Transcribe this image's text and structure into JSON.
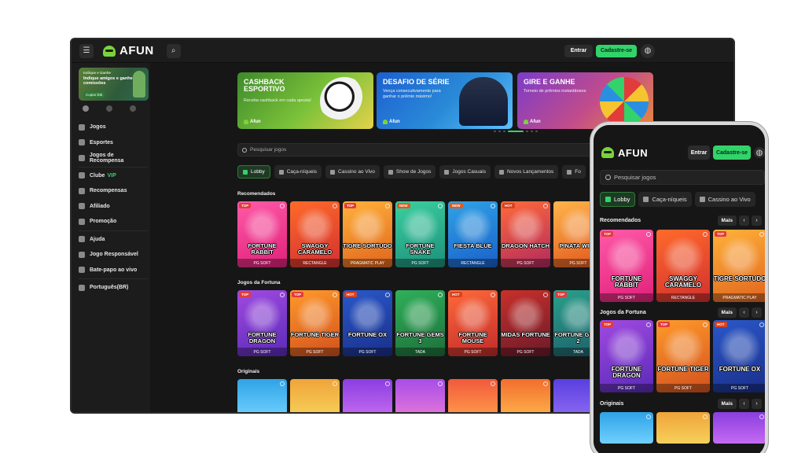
{
  "brand": {
    "name": "AFUN",
    "accent": "#32d36a"
  },
  "header": {
    "login_label": "Entrar",
    "signup_label": "Cadastre-se"
  },
  "sidebar": {
    "promo": {
      "kicker": "Indique e Ganhe",
      "title": "Indique amigos e ganhe comissões",
      "cta": "Copiar link"
    },
    "items": [
      {
        "label": "Jogos",
        "icon": "dice-icon"
      },
      {
        "label": "Esportes",
        "icon": "ball-icon"
      },
      {
        "label": "Jogos de Recompensa",
        "icon": "gift-icon"
      },
      {
        "label": "Clube",
        "extra": "VIP",
        "icon": "crown-icon"
      },
      {
        "label": "Recompensas",
        "icon": "calendar-icon"
      },
      {
        "label": "Afiliado",
        "icon": "users-icon"
      },
      {
        "label": "Promoção",
        "icon": "tag-icon"
      },
      {
        "label": "Ajuda",
        "icon": "help-icon"
      },
      {
        "label": "Jogo Responsável",
        "icon": "shield-icon"
      },
      {
        "label": "Bate-papo ao vivo",
        "icon": "headset-icon"
      },
      {
        "label": "Português(BR)",
        "icon": "globe-icon"
      }
    ]
  },
  "banners": [
    {
      "title": "CASHBACK ESPORTIVO",
      "subtitle": "Receba cashback em cada aposta!",
      "brand": "Afun"
    },
    {
      "title": "DESAFIO DE SÉRIE",
      "subtitle": "Vença consecutivamente para ganhar o prêmio máximo!",
      "brand": "Afun"
    },
    {
      "title": "GIRE E GANHE",
      "subtitle": "Torneio de prêmios instantâneos",
      "brand": "Afun"
    }
  ],
  "search": {
    "placeholder": "Pesquisar jogos"
  },
  "tabs": [
    "Lobby",
    "Caça-níqueis",
    "Cassino ao Vivo",
    "Show de Jogos",
    "Jogos Casuais",
    "Novos Lançamentos",
    "Fo"
  ],
  "sections": {
    "recommended": "Recomendados",
    "fortune": "Jogos da Fortuna",
    "originals": "Originais",
    "more": "Mais"
  },
  "recommended": [
    {
      "title": "FORTUNE RABBIT",
      "provider": "PG SOFT",
      "badge": "TOP"
    },
    {
      "title": "SWAGGY CARAMELO",
      "provider": "RECTANGLE",
      "badge": ""
    },
    {
      "title": "TIGRE SORTUDO",
      "provider": "PRAGMATIC PLAY",
      "badge": "TOP"
    },
    {
      "title": "FORTUNE SNAKE",
      "provider": "PG SOFT",
      "badge": "NEW"
    },
    {
      "title": "FIESTA BLUE",
      "provider": "RECTANGLE",
      "badge": "NEW"
    },
    {
      "title": "DRAGON HATCH",
      "provider": "PG SOFT",
      "badge": "HOT"
    },
    {
      "title": "PINATA WINS",
      "provider": "PG SOFT",
      "badge": ""
    }
  ],
  "fortune": [
    {
      "title": "FORTUNE DRAGON",
      "provider": "PG SOFT",
      "badge": "TOP"
    },
    {
      "title": "FORTUNE TIGER",
      "provider": "PG SOFT",
      "badge": "TOP"
    },
    {
      "title": "FORTUNE OX",
      "provider": "PG SOFT",
      "badge": "HOT"
    },
    {
      "title": "FORTUNE GEMS 3",
      "provider": "TADA",
      "badge": ""
    },
    {
      "title": "FORTUNE MOUSE",
      "provider": "PG SOFT",
      "badge": "HOT"
    },
    {
      "title": "MIDAS FORTUNE",
      "provider": "PG SOFT",
      "badge": ""
    },
    {
      "title": "FORTUNE GEMS 2",
      "provider": "TADA",
      "badge": "TOP"
    }
  ],
  "phone": {
    "tabs": [
      "Lobby",
      "Caça-níqueis",
      "Cassino ao Vivo"
    ],
    "recommended": [
      {
        "title": "FORTUNE RABBIT",
        "provider": "PG SOFT",
        "badge": "TOP"
      },
      {
        "title": "SWAGGY CARAMELO",
        "provider": "RECTANGLE",
        "badge": ""
      },
      {
        "title": "TIGRE SORTUDO",
        "provider": "PRAGMATIC PLAY",
        "badge": "TOP"
      }
    ],
    "fortune": [
      {
        "title": "FORTUNE DRAGON",
        "provider": "PG SOFT",
        "badge": "TOP"
      },
      {
        "title": "FORTUNE TIGER",
        "provider": "PG SOFT",
        "badge": "TOP"
      },
      {
        "title": "FORTUNE OX",
        "provider": "PG SOFT",
        "badge": "HOT"
      }
    ]
  }
}
